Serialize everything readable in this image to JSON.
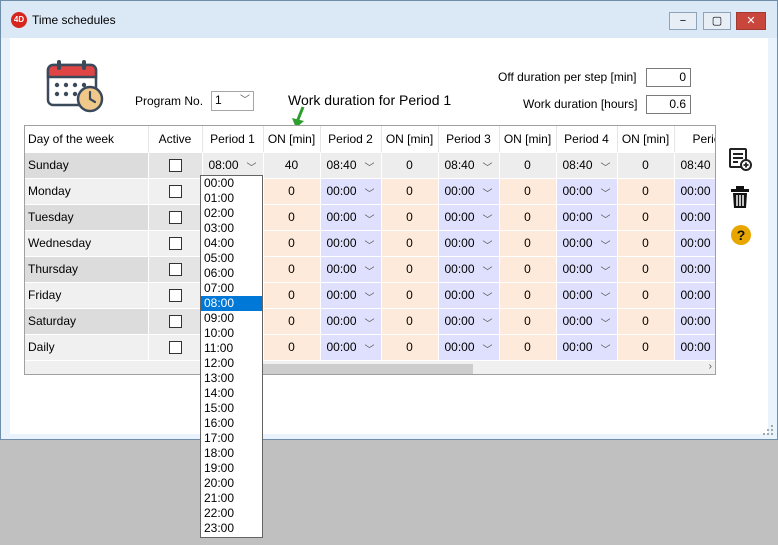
{
  "window": {
    "title": "Time schedules",
    "app_badge": "4D",
    "controls": {
      "minimize": "−",
      "restore": "▢",
      "close": "✕"
    }
  },
  "program": {
    "label": "Program No.",
    "selected": "1"
  },
  "annotation": "Work duration for Period 1",
  "settings": {
    "off_duration_label": "Off duration per step [min]",
    "off_duration_value": "0",
    "work_duration_label": "Work duration [hours]",
    "work_duration_value": "0.6"
  },
  "table": {
    "headers": [
      "Day of the week",
      "Active",
      "Period 1",
      "ON [min]",
      "Period 2",
      "ON [min]",
      "Period 3",
      "ON [min]",
      "Period 4",
      "ON [min]",
      "Perioc"
    ],
    "rows": [
      {
        "day": "Sunday",
        "p1": "08:00",
        "on1": "40",
        "p2": "08:40",
        "on2": "0",
        "p3": "08:40",
        "on3": "0",
        "p4": "08:40",
        "on4": "0",
        "p5": "08:40"
      },
      {
        "day": "Monday",
        "p1": "",
        "on1": "0",
        "p2": "00:00",
        "on2": "0",
        "p3": "00:00",
        "on3": "0",
        "p4": "00:00",
        "on4": "0",
        "p5": "00:00"
      },
      {
        "day": "Tuesday",
        "p1": "",
        "on1": "0",
        "p2": "00:00",
        "on2": "0",
        "p3": "00:00",
        "on3": "0",
        "p4": "00:00",
        "on4": "0",
        "p5": "00:00"
      },
      {
        "day": "Wednesday",
        "p1": "",
        "on1": "0",
        "p2": "00:00",
        "on2": "0",
        "p3": "00:00",
        "on3": "0",
        "p4": "00:00",
        "on4": "0",
        "p5": "00:00"
      },
      {
        "day": "Thursday",
        "p1": "",
        "on1": "0",
        "p2": "00:00",
        "on2": "0",
        "p3": "00:00",
        "on3": "0",
        "p4": "00:00",
        "on4": "0",
        "p5": "00:00"
      },
      {
        "day": "Friday",
        "p1": "",
        "on1": "0",
        "p2": "00:00",
        "on2": "0",
        "p3": "00:00",
        "on3": "0",
        "p4": "00:00",
        "on4": "0",
        "p5": "00:00"
      },
      {
        "day": "Saturday",
        "p1": "",
        "on1": "0",
        "p2": "00:00",
        "on2": "0",
        "p3": "00:00",
        "on3": "0",
        "p4": "00:00",
        "on4": "0",
        "p5": "00:00"
      },
      {
        "day": "Daily",
        "p1": "",
        "on1": "0",
        "p2": "00:00",
        "on2": "0",
        "p3": "00:00",
        "on3": "0",
        "p4": "00:00",
        "on4": "0",
        "p5": "00:00"
      }
    ]
  },
  "dropdown": {
    "options": [
      "00:00",
      "01:00",
      "02:00",
      "03:00",
      "04:00",
      "05:00",
      "06:00",
      "07:00",
      "08:00",
      "09:00",
      "10:00",
      "11:00",
      "12:00",
      "13:00",
      "14:00",
      "15:00",
      "16:00",
      "17:00",
      "18:00",
      "19:00",
      "20:00",
      "21:00",
      "22:00",
      "23:00"
    ],
    "selected": "08:00"
  },
  "side_icons": [
    "add-list-icon",
    "trash-icon",
    "help-icon"
  ],
  "help_glyph": "?",
  "colors": {
    "selection": "#0078d7",
    "period_blue": "#dfe0fd",
    "on_peach": "#fdeadb",
    "annotation_arrow": "#2e9e2e",
    "help_yellow": "#e8a600"
  }
}
